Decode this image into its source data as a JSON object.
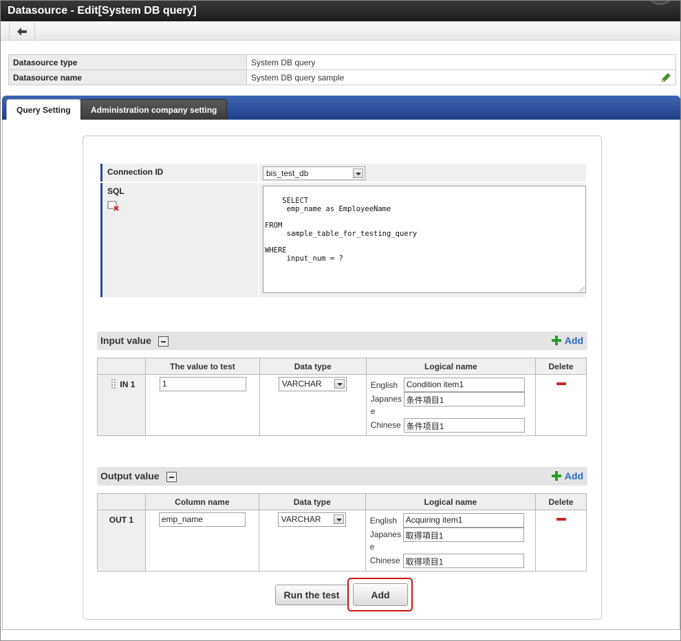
{
  "window": {
    "title": "Datasource - Edit[System DB query]"
  },
  "toolbar": {
    "back_icon": "back-arrow-icon"
  },
  "info": {
    "rows": [
      {
        "label": "Datasource type",
        "value": "System DB query"
      },
      {
        "label": "Datasource name",
        "value": "System DB query sample"
      }
    ],
    "edit_icon": "pencil-icon"
  },
  "tabs": [
    {
      "label": "Query Setting",
      "active": true
    },
    {
      "label": "Administration company setting",
      "active": false
    }
  ],
  "query": {
    "connection_label": "Connection ID",
    "connection_value": "bis_test_db",
    "sql_label": "SQL",
    "sql_text": "SELECT\n     emp_name as EmployeeName\n\nFROM\n     sample_table_for_testing_query\n\nWHERE\n     input_num = ?"
  },
  "input_section": {
    "title": "Input value",
    "add_label": "Add",
    "columns": [
      "",
      "The value to test",
      "Data type",
      "Logical name",
      "Delete"
    ],
    "rows": [
      {
        "id": "IN 1",
        "value": "1",
        "data_type": "VARCHAR",
        "names": [
          {
            "lang": "English",
            "value": "Condition item1"
          },
          {
            "lang": "Japanese",
            "value": "条件項目1"
          },
          {
            "lang": "Chinese",
            "value": "条件项目1"
          }
        ]
      }
    ]
  },
  "output_section": {
    "title": "Output value",
    "add_label": "Add",
    "columns": [
      "",
      "Column name",
      "Data type",
      "Logical name",
      "Delete"
    ],
    "rows": [
      {
        "id": "OUT 1",
        "value": "emp_name",
        "data_type": "VARCHAR",
        "names": [
          {
            "lang": "English",
            "value": "Acquiring item1"
          },
          {
            "lang": "Japanese",
            "value": "取得項目1"
          },
          {
            "lang": "Chinese",
            "value": "取得项目1"
          }
        ]
      }
    ]
  },
  "buttons": {
    "run_test": "Run the test",
    "add": "Add"
  },
  "colors": {
    "tab_bar": "#1e3f86",
    "highlight": "#d01010",
    "add_link": "#2a6bc4",
    "delete": "#cc2222"
  }
}
